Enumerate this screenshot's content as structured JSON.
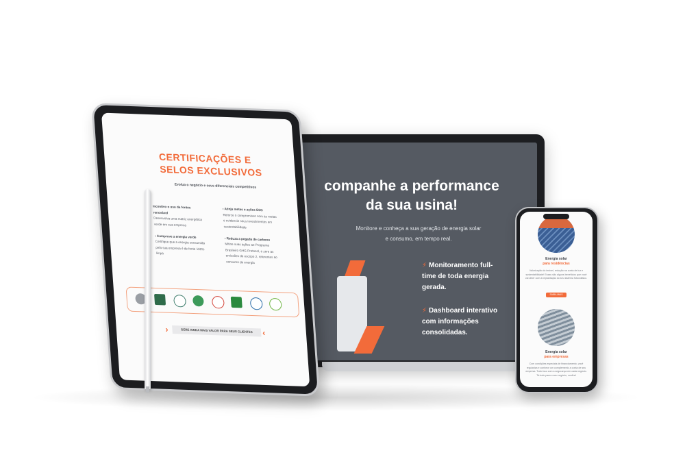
{
  "laptop": {
    "headline_line1": "companhe a performance",
    "headline_line2": "da sua usina!",
    "subtitle_line1": "Monitore e conheça a sua geração de energia solar",
    "subtitle_line2": "e consumo, em tempo real.",
    "features": [
      {
        "line1": "Monitoramento full-",
        "line2": "time de toda energia",
        "line3": "gerada.",
        "icon": "lightning-icon"
      },
      {
        "line1": "Dashboard interativo",
        "line2": "com informações",
        "line3": "consolidadas.",
        "icon": "lightning-icon"
      }
    ]
  },
  "tablet": {
    "title_line1": "CERTIFICAÇÕES E",
    "title_line2": "SELOS EXCLUSIVOS",
    "subtitle": "Evolua o negócio e seus diferenciais competitivos",
    "col_left": {
      "h1": "Incentivo o uso da fontes",
      "h1b": "renovável",
      "p1a": "Desenvolva uma matriz energética",
      "p1b": "verde em sua empresa",
      "h2": "Comprove a energia verde",
      "p2a": "Certifique que a energia consumida",
      "p2b": "pela sua empresa é de fonte 100%",
      "p2c": "limpa"
    },
    "col_right": {
      "h1": "Atinja metas e ações ESG",
      "p1a": "Reforce o compromisso com as metas",
      "p1b": "e evidencie seus investimentos em",
      "p1c": "sustentabilidade",
      "h2": "Reduza a pegada de carbono",
      "p2a": "Mitine suas ações ao Programa",
      "p2b": "Brasileiro GHG Protocol, e zere as",
      "p2c": "emissões de escopo 2, referentes ao",
      "p2d": "consumo de energia"
    },
    "logos": [
      "leed-logo",
      "fsc-logo",
      "seal-logo",
      "green-seal-logo",
      "eco-logo",
      "ibd-logo",
      "cert-logo",
      "green-badge-logo"
    ],
    "cta": "GERE AINDA MAIS VALOR PARA SEUS CLIENTES"
  },
  "phone": {
    "card1_title": "Energia solar",
    "card1_sub": "para residências",
    "card1_text": "Valorização do imóvel, redução na conta de luz e sustentabilidade! Essas são alguns benefícios que você vai obter com a implantação do seu sistema fotovoltaico.",
    "card1_btn": "SAIBA MAIS",
    "card2_title": "Energia solar",
    "card2_sub": "para empresas",
    "card2_text": "Com condições especiais de financiamento, você regulariza e conhece um complemento a conta de seu empresa. Tudo isso com a segurança em cada negócio. Tá tudo para o seu negócio, confira!"
  },
  "colors": {
    "accent": "#f26b3a",
    "laptop_bg": "#555a62",
    "dark": "#1c1d20"
  }
}
